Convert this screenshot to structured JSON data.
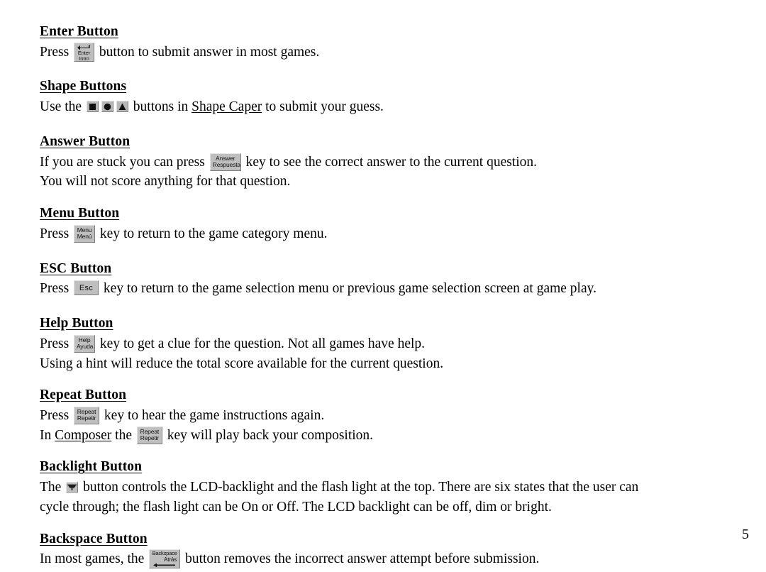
{
  "page": {
    "number": "5"
  },
  "sections": [
    {
      "id": "enter",
      "heading": "Enter Button",
      "lines": [
        {
          "pre": "Press ",
          "post": " button to submit answer in most games."
        }
      ],
      "key": {
        "name": "enter-key",
        "line1": "Enter",
        "line2": "Intro",
        "glyph": "return-arrow-icon"
      }
    },
    {
      "id": "shape",
      "heading": "Shape Buttons",
      "lines": [
        {
          "pre": "Use the ",
          "mid": " buttons in ",
          "link": "Shape Caper",
          "post": " to submit your guess."
        }
      ],
      "shapes": [
        {
          "name": "square-shape-button",
          "glyph": "square-icon"
        },
        {
          "name": "circle-shape-button",
          "glyph": "circle-icon"
        },
        {
          "name": "triangle-shape-button",
          "glyph": "triangle-icon"
        }
      ]
    },
    {
      "id": "answer",
      "heading": "Answer Button",
      "lines": [
        {
          "pre": "If you are stuck you can press ",
          "post": " key to see the correct answer to the current question."
        },
        {
          "text": "You will not score anything for that question."
        }
      ],
      "key": {
        "name": "answer-key",
        "line1": "Answer",
        "line2": "Respuesta"
      }
    },
    {
      "id": "menu",
      "heading": "Menu Button",
      "lines": [
        {
          "pre": "Press ",
          "post": " key to return to the game category menu."
        }
      ],
      "key": {
        "name": "menu-key",
        "line1": "Menu",
        "line2": "Menú"
      }
    },
    {
      "id": "esc",
      "heading": "ESC Button",
      "lines": [
        {
          "pre": "Press ",
          "post": " key to return to the game selection menu or previous game selection screen at game play."
        }
      ],
      "key": {
        "name": "esc-key",
        "line1": "Esc"
      }
    },
    {
      "id": "help",
      "heading": "Help Button",
      "lines": [
        {
          "pre": "Press ",
          "post": " key to get a clue for the question. Not all games have help."
        },
        {
          "text": "Using a hint will reduce the total score available for the current question."
        }
      ],
      "key": {
        "name": "help-key",
        "line1": "Help",
        "line2": "Ayuda"
      }
    },
    {
      "id": "repeat",
      "heading": "Repeat Button",
      "lines": [
        {
          "pre": "Press ",
          "post": " key to hear the game instructions again."
        },
        {
          "pre": "In ",
          "link": "Composer",
          "mid": " the ",
          "post": " key will play back your composition."
        }
      ],
      "key": {
        "name": "repeat-key",
        "line1": "Repeat",
        "line2": "Repetir"
      }
    },
    {
      "id": "backlight",
      "heading": "Backlight Button",
      "lines": [
        {
          "pre": "The ",
          "post": " button controls the LCD-backlight and the flash light at the top. There are six states that the user can"
        },
        {
          "text": "cycle through; the flash light can be On or Off. The LCD backlight can be off, dim or bright."
        }
      ],
      "key": {
        "name": "backlight-key",
        "glyph": "lamp-icon"
      }
    },
    {
      "id": "backspace",
      "heading": "Backspace Button",
      "lines": [
        {
          "pre": "In most games, the ",
          "post": " button removes the incorrect answer attempt before submission."
        }
      ],
      "key": {
        "name": "backspace-key",
        "line1": "Backspace",
        "line2": "Atrás",
        "glyph": "left-arrow-icon"
      }
    }
  ],
  "colors": {
    "key_face": "#bfbfbf",
    "key_highlight": "#e3e3e3",
    "key_shadow": "#7d7d7d",
    "text": "#000000",
    "page_background": "#ffffff"
  }
}
